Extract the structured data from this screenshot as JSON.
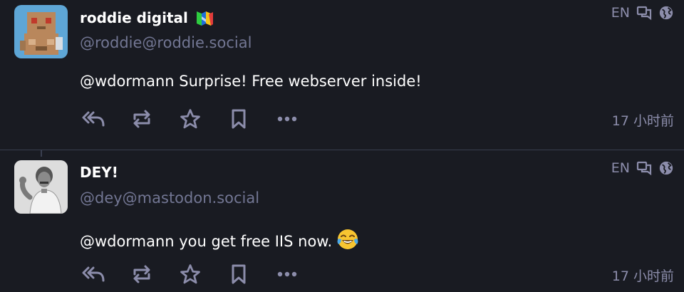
{
  "posts": [
    {
      "display_name": "roddie digital",
      "handle": "@roddie@roddie.social",
      "content": "@wdormann Surprise! Free webserver inside!",
      "language": "EN",
      "timestamp": "17 小时前",
      "name_emoji": "n64-logo-icon",
      "content_emoji": ""
    },
    {
      "display_name": "DEY!",
      "handle": "@dey@mastodon.social",
      "content": "@wdormann you get free IIS now.",
      "language": "EN",
      "timestamp": "17 小时前",
      "name_emoji": "",
      "content_emoji": "tears-of-joy-emoji"
    }
  ],
  "colors": {
    "background": "#191b22",
    "text": "#ffffff",
    "muted": "#727693",
    "icon": "#8c8dab",
    "divider": "#393f4f"
  }
}
